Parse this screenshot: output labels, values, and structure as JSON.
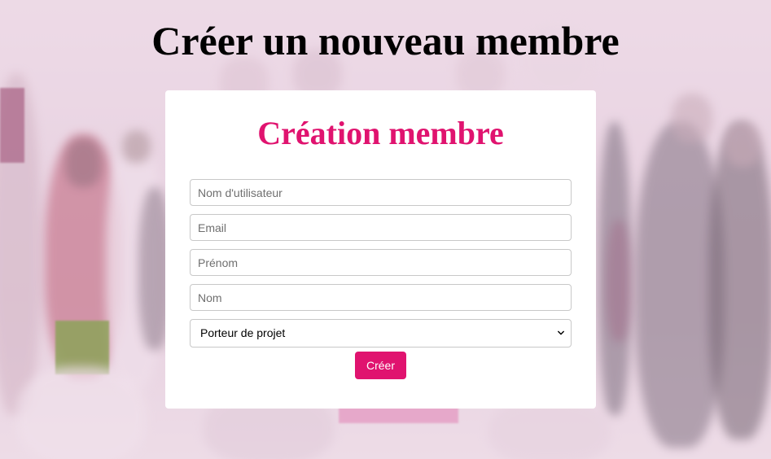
{
  "page": {
    "title": "Créer un nouveau membre"
  },
  "form": {
    "title": "Création membre",
    "username_placeholder": "Nom d'utilisateur",
    "email_placeholder": "Email",
    "firstname_placeholder": "Prénom",
    "lastname_placeholder": "Nom",
    "role_select": {
      "selected": "Porteur de projet"
    },
    "submit_label": "Créer"
  },
  "colors": {
    "accent": "#e0136f",
    "background_tint": "#ecdbe6",
    "card": "#ffffff"
  }
}
